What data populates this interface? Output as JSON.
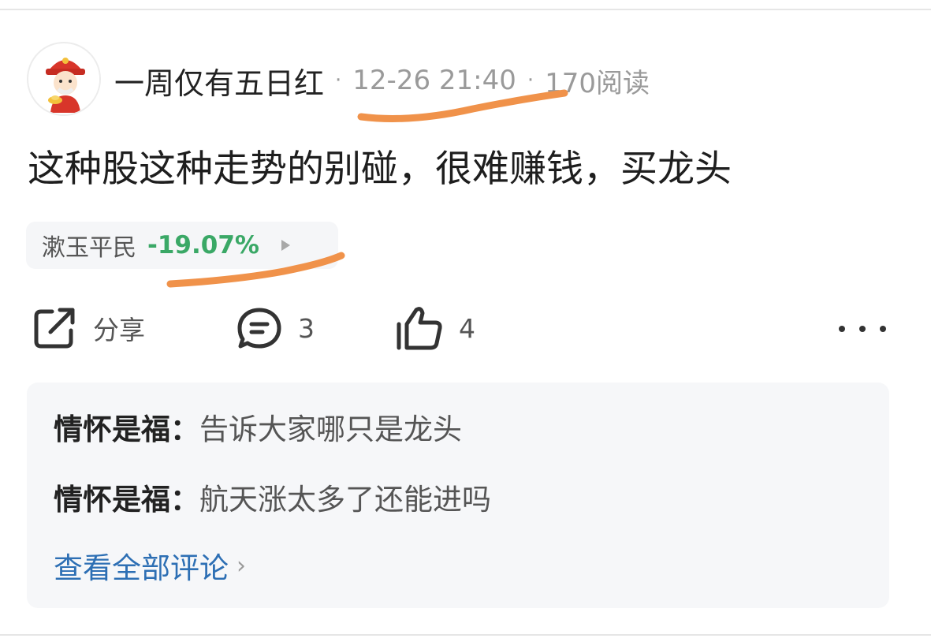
{
  "post": {
    "author": "一周仅有五日红",
    "timestamp": "12-26 21:40",
    "reads": "170阅读",
    "separator": "·",
    "content": "这种股这种走势的别碰，很难赚钱，买龙头"
  },
  "stock": {
    "name": "漱玉平民",
    "change": "-19.07%",
    "change_color": "#3aa866"
  },
  "actions": {
    "share_label": "分享",
    "comment_count": "3",
    "like_count": "4",
    "share_icon": "share-icon",
    "comment_icon": "comment-icon",
    "like_icon": "thumbs-up-icon",
    "more_icon": "more-icon"
  },
  "comments": [
    {
      "author": "情怀是福：",
      "text": "告诉大家哪只是龙头"
    },
    {
      "author": "情怀是福：",
      "text": "航天涨太多了还能进吗"
    }
  ],
  "view_all": {
    "label": "查看全部评论",
    "chevron": "›"
  },
  "colors": {
    "annotation_marker": "#f0924a",
    "link": "#2d6fb4",
    "stock_down": "#3aa866"
  }
}
